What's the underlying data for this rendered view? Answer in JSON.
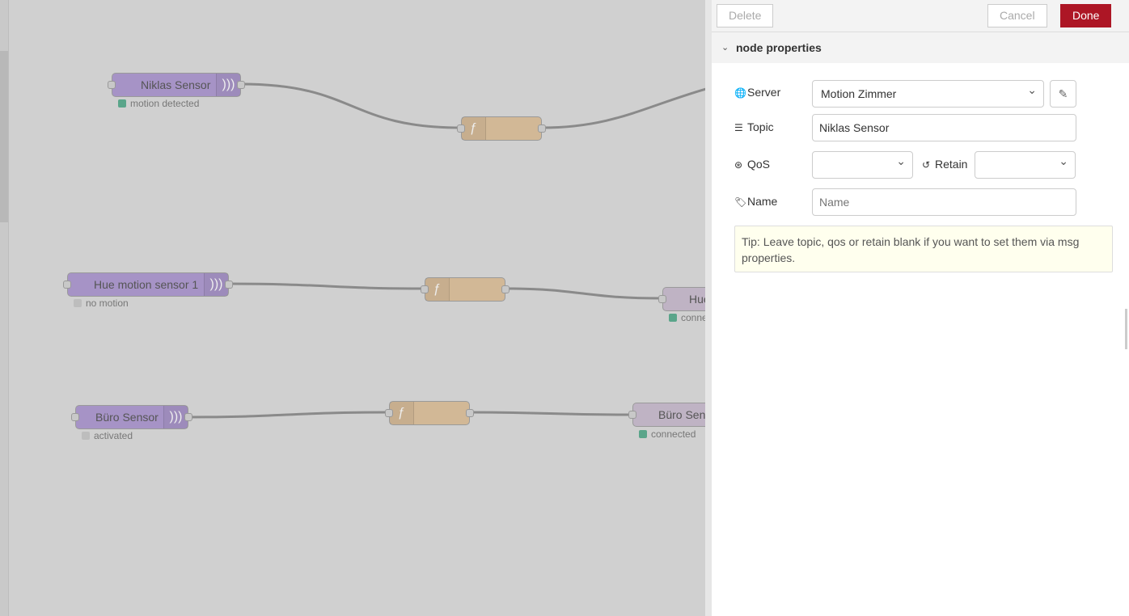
{
  "canvas": {
    "nodes": [
      {
        "label": "Niklas Sensor",
        "status": "motion detected",
        "status_color": "#5aa58a"
      },
      {
        "label": "Hue motion sensor 1",
        "status": "no motion",
        "status_color": "#bdbdbd"
      },
      {
        "label": "Büro Sensor",
        "status": "activated",
        "status_color": "#bdbdbd"
      },
      {
        "label": "Hue",
        "status": "conne",
        "status_color": "#5aa58a"
      },
      {
        "label": "Büro Sens",
        "status": "connected",
        "status_color": "#5aa58a"
      }
    ],
    "function_icon": "ƒ",
    "inject_icon": ")))"
  },
  "tray": {
    "delete_label": "Delete",
    "cancel_label": "Cancel",
    "done_label": "Done",
    "section_title": "node properties",
    "server_label": "Server",
    "server_value": "Motion Zimmer",
    "topic_label": "Topic",
    "topic_value": "Niklas Sensor",
    "qos_label": "QoS",
    "qos_value": "",
    "retain_label": "Retain",
    "retain_value": "",
    "name_label": "Name",
    "name_placeholder": "Name",
    "tip": "Tip: Leave topic, qos or retain blank if you want to set them via msg properties."
  },
  "colors": {
    "done": "#ad1625",
    "inject": "#a693c6",
    "function": "#d2b896"
  }
}
